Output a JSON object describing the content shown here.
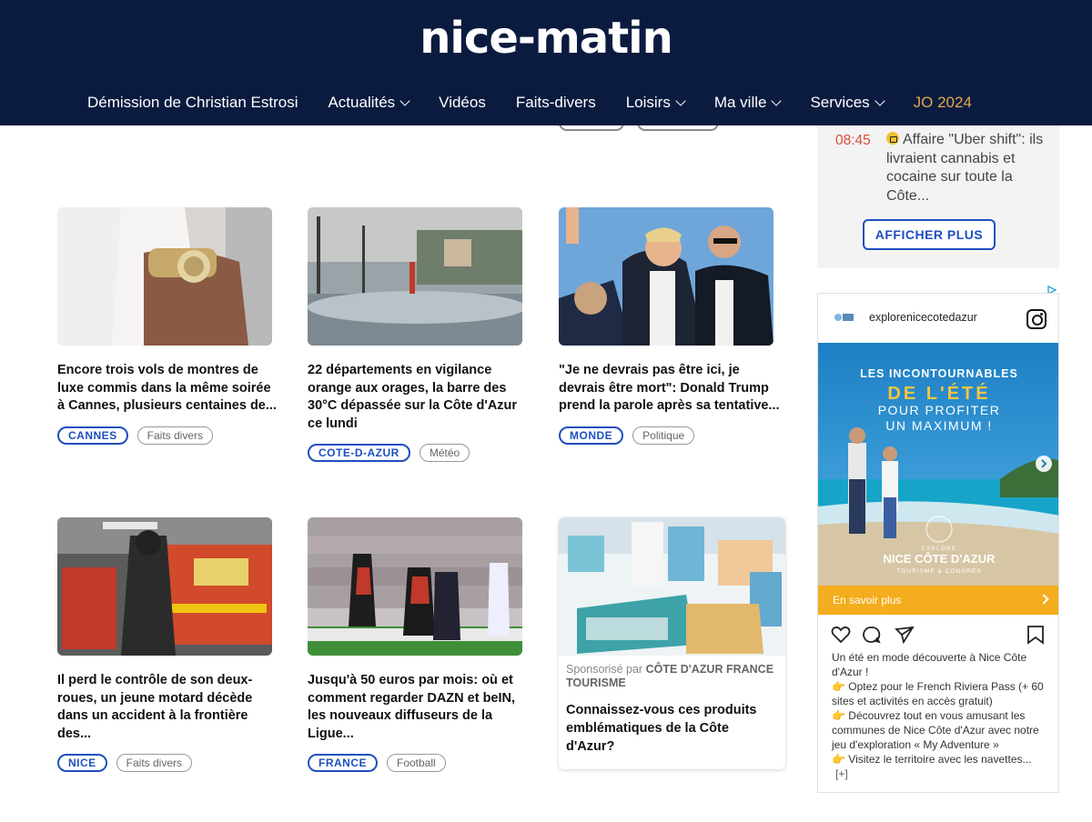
{
  "header": {
    "logo": "nice-matin",
    "nav": [
      {
        "label": "Démission de Christian Estrosi",
        "chevron": false
      },
      {
        "label": "Actualités",
        "chevron": true
      },
      {
        "label": "Vidéos",
        "chevron": false
      },
      {
        "label": "Faits-divers",
        "chevron": false
      },
      {
        "label": "Loisirs",
        "chevron": true
      },
      {
        "label": "Ma ville",
        "chevron": true
      },
      {
        "label": "Services",
        "chevron": true
      },
      {
        "label": "JO 2024",
        "chevron": false,
        "accent": "#e2a94e"
      }
    ]
  },
  "articles": [
    {
      "title": "Encore trois vols de montres de luxe commis dans la même soirée à Cannes, plusieurs centaines de...",
      "location": "CANNES",
      "category": "Faits divers",
      "image": "watch-wrist-photo"
    },
    {
      "title": "22 départements en vigilance orange aux orages, la barre des 30°C dépassée sur la Côte d'Azur ce lundi",
      "location": "COTE-D-AZUR",
      "category": "Météo",
      "image": "promenade-rain-photo"
    },
    {
      "title": "\"Je ne devrais pas être ici, je devrais être mort\": Donald Trump prend la parole après sa tentative...",
      "location": "MONDE",
      "category": "Politique",
      "image": "trump-rally-photo"
    },
    {
      "title": "Il perd le contrôle de son deux-roues, un jeune motard décède dans un accident à la frontière des...",
      "location": "NICE",
      "category": "Faits divers",
      "image": "fire-truck-photo"
    },
    {
      "title": "Jusqu'à 50 euros par mois: où et comment regarder DAZN et beIN, les nouveaux diffuseurs de la Ligue...",
      "location": "FRANCE",
      "category": "Football",
      "image": "football-match-photo"
    }
  ],
  "sponsored": {
    "label_prefix": "Sponsorisé par",
    "sponsor": "CÔTE D'AZUR FRANCE TOURISME",
    "title": "Connaissez-vous ces produits emblématiques de la Côte d'Azur?",
    "image": "provence-products-photo"
  },
  "live": {
    "time": "08:45",
    "text": "Affaire \"Uber shift\": ils livraient cannabis et cocaine sur toute la Côte...",
    "button": "AFFICHER PLUS"
  },
  "instagram_ad": {
    "username": "explorenicecotedazur",
    "image_lines": [
      "LES INCONTOURNABLES",
      "DE L'ÉTÉ",
      "POUR PROFITER",
      "UN MAXIMUM !"
    ],
    "brand_small": "EXPLORE",
    "brand": "NICE CÔTE D'AZUR",
    "brand_sub": "TOURISME & CONGRÈS",
    "cta": "En savoir plus",
    "caption": [
      "Un été en mode découverte à Nice Côte d'Azur !",
      "Optez pour le French Riviera Pass (+ 60 sites et activités en accès gratuit)",
      "Découvrez tout en vous amusant les communes de Nice Côte d'Azur avec notre jeu d'exploration « My Adventure »",
      "Visitez le territoire avec les navettes..."
    ],
    "more": "[+]"
  },
  "colors": {
    "header_bg": "#0b1b3f",
    "accent_blue": "#1d4fbf",
    "live_time": "#d84d3a",
    "cta_orange": "#f4ad1e"
  }
}
